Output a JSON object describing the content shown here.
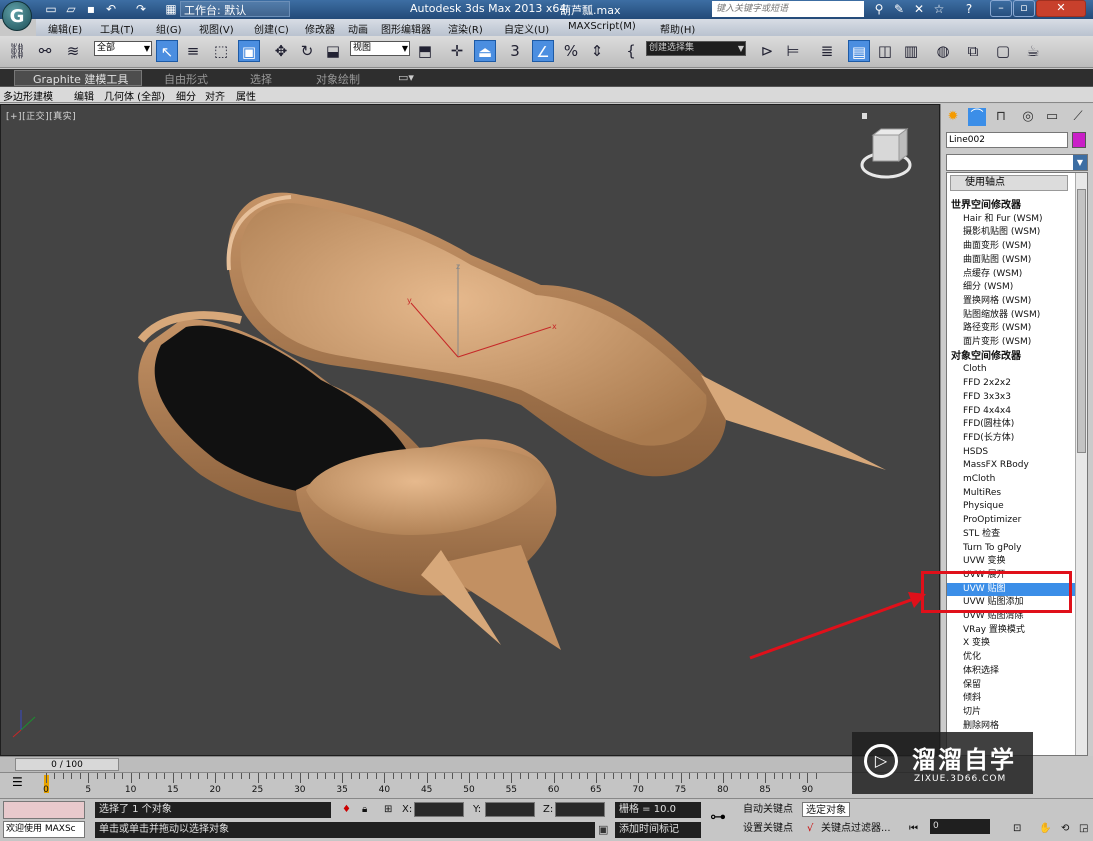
{
  "window": {
    "workspace": "工作台: 默认",
    "app_title": "Autodesk 3ds Max  2013 x64",
    "file_name": "葫芦瓢.max",
    "search_placeholder": "键入关键字或短语",
    "app_logo_letter": "G"
  },
  "menu": [
    "编辑(E)",
    "工具(T)",
    "组(G)",
    "视图(V)",
    "创建(C)",
    "修改器",
    "动画",
    "图形编辑器",
    "渲染(R)",
    "自定义(U)",
    "MAXScript(M)",
    "帮助(H)"
  ],
  "toolbar": {
    "selection_filter": "全部",
    "reference_coord": "视图",
    "snap_numbers": [
      "3",
      "%"
    ],
    "named_selection": "创建选择集"
  },
  "ribbon": {
    "tabs": [
      "Graphite 建模工具",
      "自由形式",
      "选择",
      "对象绘制"
    ],
    "subtabs": [
      "多边形建模",
      "编辑",
      "几何体 (全部)",
      "细分",
      "对齐",
      "属性"
    ]
  },
  "viewport": {
    "label": "[+][正交][真实]",
    "gizmo_axes": [
      "x",
      "y",
      "z"
    ]
  },
  "command_panel": {
    "object_name": "Line002",
    "object_color": "#c91ec7",
    "pivot_button": "使用轴点",
    "modifier_list": [
      {
        "label": "世界空间修改器",
        "type": "head"
      },
      {
        "label": "Hair 和 Fur (WSM)",
        "type": "item"
      },
      {
        "label": "摄影机贴图 (WSM)",
        "type": "item"
      },
      {
        "label": "曲面变形 (WSM)",
        "type": "item"
      },
      {
        "label": "曲面贴图 (WSM)",
        "type": "item"
      },
      {
        "label": "点缓存 (WSM)",
        "type": "item"
      },
      {
        "label": "细分 (WSM)",
        "type": "item"
      },
      {
        "label": "置换网格 (WSM)",
        "type": "item"
      },
      {
        "label": "贴图缩放器 (WSM)",
        "type": "item"
      },
      {
        "label": "路径变形 (WSM)",
        "type": "item"
      },
      {
        "label": "面片变形 (WSM)",
        "type": "item"
      },
      {
        "label": "对象空间修改器",
        "type": "head"
      },
      {
        "label": "Cloth",
        "type": "item"
      },
      {
        "label": "FFD 2x2x2",
        "type": "item"
      },
      {
        "label": "FFD 3x3x3",
        "type": "item"
      },
      {
        "label": "FFD 4x4x4",
        "type": "item"
      },
      {
        "label": "FFD(圆柱体)",
        "type": "item"
      },
      {
        "label": "FFD(长方体)",
        "type": "item"
      },
      {
        "label": "HSDS",
        "type": "item"
      },
      {
        "label": "MassFX RBody",
        "type": "item"
      },
      {
        "label": "mCloth",
        "type": "item"
      },
      {
        "label": "MultiRes",
        "type": "item"
      },
      {
        "label": "Physique",
        "type": "item"
      },
      {
        "label": "ProOptimizer",
        "type": "item"
      },
      {
        "label": "STL 检查",
        "type": "item"
      },
      {
        "label": "Turn To gPoly",
        "type": "item"
      },
      {
        "label": "UVW 变换",
        "type": "item"
      },
      {
        "label": "UVW 展开",
        "type": "item"
      },
      {
        "label": "UVW 贴图",
        "type": "selected"
      },
      {
        "label": "UVW 贴图添加",
        "type": "item"
      },
      {
        "label": "UVW 贴图清除",
        "type": "item"
      },
      {
        "label": "VRay 置换模式",
        "type": "item"
      },
      {
        "label": "X 变换",
        "type": "item"
      },
      {
        "label": "优化",
        "type": "item"
      },
      {
        "label": "体积选择",
        "type": "item"
      },
      {
        "label": "保留",
        "type": "item"
      },
      {
        "label": "倾斜",
        "type": "item"
      },
      {
        "label": "切片",
        "type": "item"
      },
      {
        "label": "删除网格",
        "type": "item"
      }
    ]
  },
  "timeline": {
    "slider": "0 / 100",
    "ticks": [
      "0",
      "5",
      "10",
      "15",
      "20",
      "25",
      "30",
      "35",
      "40",
      "45",
      "50",
      "55",
      "60",
      "65",
      "70",
      "75",
      "80",
      "85",
      "90"
    ]
  },
  "status": {
    "welcome": "欢迎使用 MAXSc",
    "selection": "选择了 1 个对象",
    "prompt": "单击或单击并拖动以选择对象",
    "coord_labels": [
      "X:",
      "Y:",
      "Z:"
    ],
    "grid": "栅格 = 10.0",
    "add_time_tag": "添加时间标记",
    "auto_key": "自动关键点",
    "selected_object": "选定对象",
    "set_key": "设置关键点",
    "key_filters": "关键点过滤器...",
    "frame": "0"
  },
  "watermark": {
    "title": "溜溜自学",
    "url": "ZIXUE.3D66.COM"
  }
}
